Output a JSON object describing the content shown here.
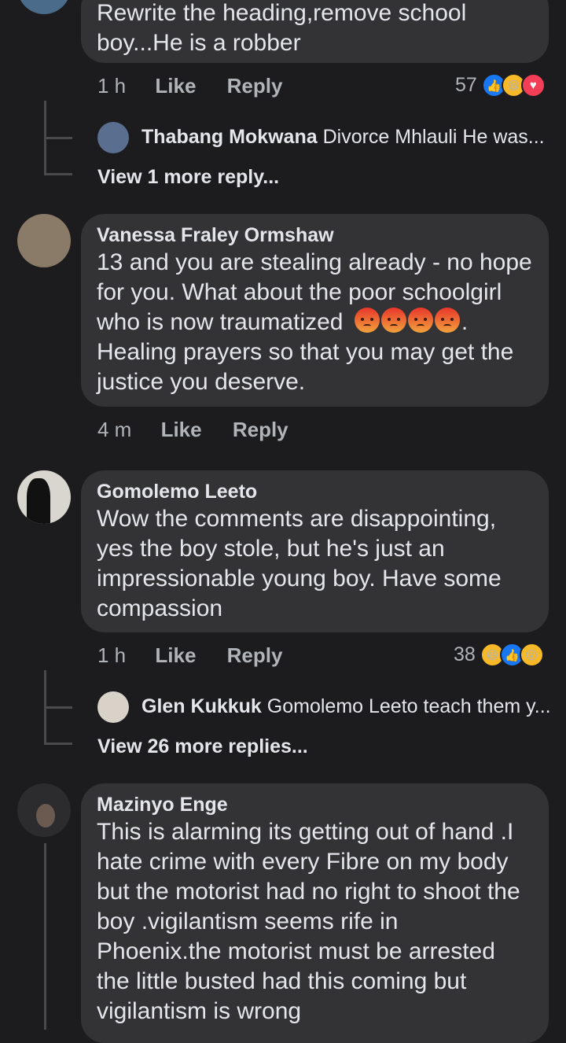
{
  "comments": [
    {
      "text_lines": [
        "Rewrite the heading,remove school",
        "boy...He is a robber"
      ],
      "time": "1 h",
      "like": "Like",
      "reply": "Reply",
      "reaction_count": "57",
      "reactions": [
        "like-icon",
        "haha-icon",
        "love-icon"
      ],
      "reply_preview": {
        "name": "Thabang Mokwana",
        "text": "Divorce Mhlauli He was..."
      },
      "more_replies": "View 1 more reply..."
    },
    {
      "name": "Vanessa Fraley Ormshaw",
      "text_lines": [
        "13 and you are stealing already - no hope",
        "for you. What about the poor schoolgirl",
        "who is now traumatized",
        "Healing prayers so that you may get the",
        "justice you deserve."
      ],
      "time": "4 m",
      "like": "Like",
      "reply": "Reply"
    },
    {
      "name": "Gomolemo Leeto",
      "text_lines": [
        "Wow the comments are disappointing,",
        "yes the boy stole, but he's just an",
        "impressionable young boy. Have some",
        "compassion"
      ],
      "time": "1 h",
      "like": "Like",
      "reply": "Reply",
      "reaction_count": "38",
      "reactions": [
        "haha-icon",
        "like-icon",
        "wow-icon"
      ],
      "reply_preview": {
        "name": "Glen Kukkuk",
        "text": "Gomolemo Leeto teach them y..."
      },
      "more_replies": "View 26 more replies..."
    },
    {
      "name": "Mazinyo Enge",
      "text_lines": [
        "This is alarming its getting out of hand .I",
        "hate crime with every Fibre on my body",
        "but the motorist had no right to shoot the",
        "boy .vigilantism seems rife in",
        "Phoenix.the motorist must be arrested",
        "the little busted had this coming but",
        "vigilantism is wrong"
      ]
    }
  ]
}
